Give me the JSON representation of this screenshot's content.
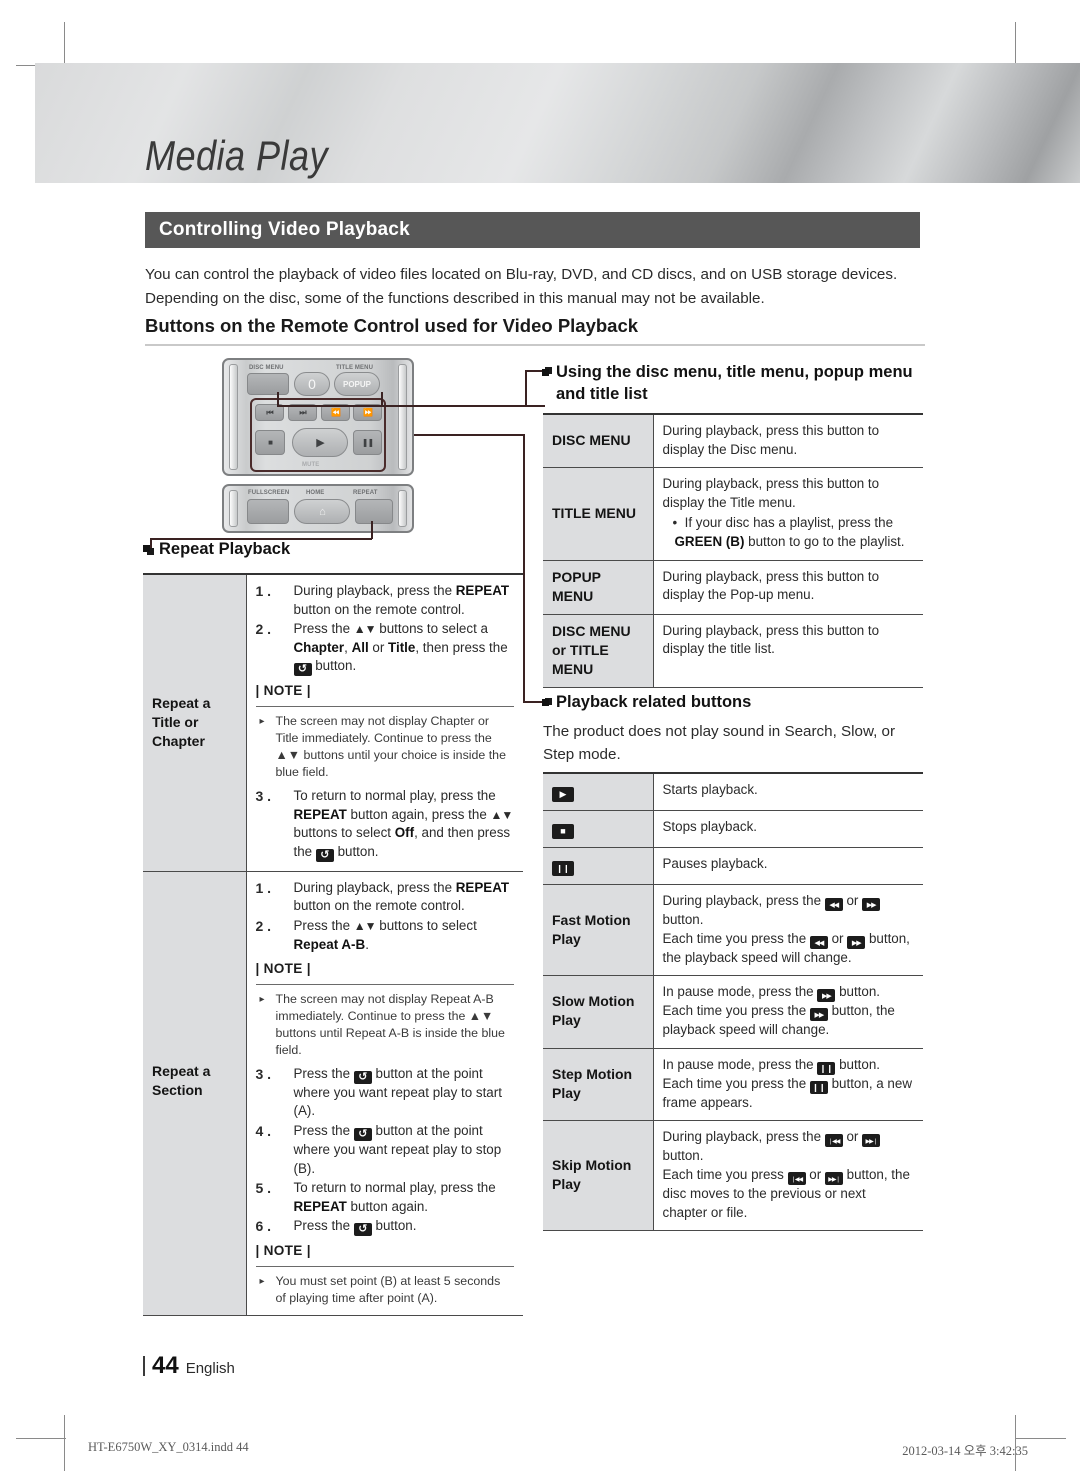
{
  "crop_marks": true,
  "header": {
    "chapter_title": "Media Play",
    "section_bar_label": "Controlling Video Playback",
    "intro_paragraph": "You can control the playback of video files located on Blu-ray, DVD, and CD discs, and on USB storage devices. Depending on the disc, some of the functions described in this manual may not be available.",
    "subheading": "Buttons on the Remote Control used for Video Playback"
  },
  "remote": {
    "labels": {
      "disc_menu": "DISC MENU",
      "title_menu": "TITLE MENU",
      "zero": "0",
      "popup": "POPUP",
      "mute": "MUTE",
      "fullscreen": "FULLSCREEN",
      "home": "HOME",
      "repeat": "REPEAT"
    },
    "transport_icons": [
      "prev-track-icon",
      "next-track-icon",
      "rewind-icon",
      "fast-forward-icon",
      "stop-icon",
      "play-icon",
      "pause-icon"
    ]
  },
  "left_column": {
    "bullet_heading": "Repeat Playback",
    "rows": [
      {
        "key": "Repeat a Title or Chapter",
        "steps_before": [
          {
            "n": "1 .",
            "html": "During playback, press the <b>REPEAT</b> button on the remote control."
          },
          {
            "n": "2 .",
            "html": "Press the <span class=\"ar\">▲▼</span> buttons to select a <b>Chapter</b>, <b>All</b> or <b>Title</b>, then press the <span class=\"ico repeat\"></span> button."
          }
        ],
        "note_label": "| NOTE |",
        "notes": [
          "The screen may not display Chapter or Title immediately. Continue to press the ▲▼ buttons until your choice is inside the blue field."
        ],
        "steps_after": [
          {
            "n": "3 .",
            "html": "To return to normal play, press the <b>REPEAT</b> button again, press the <span class=\"ar\">▲▼</span> buttons to select <b>Off</b>, and then press the <span class=\"ico repeat\"></span> button."
          }
        ]
      },
      {
        "key": "Repeat a Section",
        "steps_before": [
          {
            "n": "1 .",
            "html": "During playback, press the <b>REPEAT</b> button on the remote control."
          },
          {
            "n": "2 .",
            "html": "Press the <span class=\"ar\">▲▼</span> buttons to select <b>Repeat A-B</b>."
          }
        ],
        "note_label": "| NOTE |",
        "notes": [
          "The screen may not display Repeat A-B immediately. Continue to press the ▲▼ buttons until  Repeat A-B  is inside the blue field."
        ],
        "steps_after": [
          {
            "n": "3 .",
            "html": "Press the <span class=\"ico repeat\"></span> button at the point where you want repeat play to start (A)."
          },
          {
            "n": "4 .",
            "html": "Press the <span class=\"ico repeat\"></span> button at the point where you want repeat play to stop (B)."
          },
          {
            "n": "5 .",
            "html": "To return to normal play, press the <b>REPEAT</b> button again."
          },
          {
            "n": "6 .",
            "html": "Press the <span class=\"ico repeat\"></span> button."
          }
        ],
        "note_label_2": "| NOTE |",
        "notes_2": [
          "You must set point (B) at least 5 seconds of playing time after point (A)."
        ]
      }
    ]
  },
  "right_column": {
    "menu_section": {
      "bullet_heading": "Using the disc menu, title menu, popup menu and title list",
      "rows": [
        {
          "key": "DISC MENU",
          "html": "During playback, press this button to display the Disc menu."
        },
        {
          "key": "TITLE MENU",
          "html": "During playback, press this button to display the Title menu.<div class=\"bul\">•&nbsp; If your disc has a playlist, press the <b>GREEN (B)</b> button to go to the playlist.</div>"
        },
        {
          "key": "POPUP MENU",
          "html": "During playback, press this button to display the Pop-up menu."
        },
        {
          "key": "DISC MENU or TITLE MENU",
          "html": "During playback, press this button to display the title list."
        }
      ]
    },
    "playback_section": {
      "bullet_heading": "Playback related buttons",
      "intro": "The product does not play sound in Search, Slow, or Step mode.",
      "rows": [
        {
          "key_icon": "play-icon",
          "key": "",
          "html": "Starts playback."
        },
        {
          "key_icon": "stop-icon",
          "key": "",
          "html": "Stops playback."
        },
        {
          "key_icon": "pause-icon",
          "key": "",
          "html": "Pauses playback."
        },
        {
          "key_icon": "",
          "key": "Fast Motion Play",
          "html": "During playback, press the <span class=\"ico rw\"></span> or <span class=\"ico ff\"></span> button.<br>Each time you press the <span class=\"ico rw\"></span> or <span class=\"ico ff\"></span> button, the playback speed will change."
        },
        {
          "key_icon": "",
          "key": "Slow Motion Play",
          "html": "In pause mode, press the <span class=\"ico ff\"></span> button.<br>Each time you press the <span class=\"ico ff\"></span> button, the playback speed will change."
        },
        {
          "key_icon": "",
          "key": "Step Motion Play",
          "html": "In pause mode, press the <span class=\"ico pause\"></span> button.<br>Each time you press the <span class=\"ico pause\"></span> button, a new frame appears."
        },
        {
          "key_icon": "",
          "key": "Skip Motion Play",
          "html": "During playback, press the <span class=\"ico prev\"></span> or <span class=\"ico next\"></span> button.<br>Each time you press <span class=\"ico prev\"></span> or <span class=\"ico next\"></span> button, the disc moves to the previous or next chapter or file."
        }
      ]
    }
  },
  "footer": {
    "page_number": "44",
    "language": "English",
    "print_file": "HT-E6750W_XY_0314.indd   44",
    "print_timestamp": "2012-03-14   오후 3:42:35"
  },
  "colors": {
    "section_bar": "#575757",
    "table_key_bg": "#dcdddf",
    "rule": "#4a4a4a"
  }
}
